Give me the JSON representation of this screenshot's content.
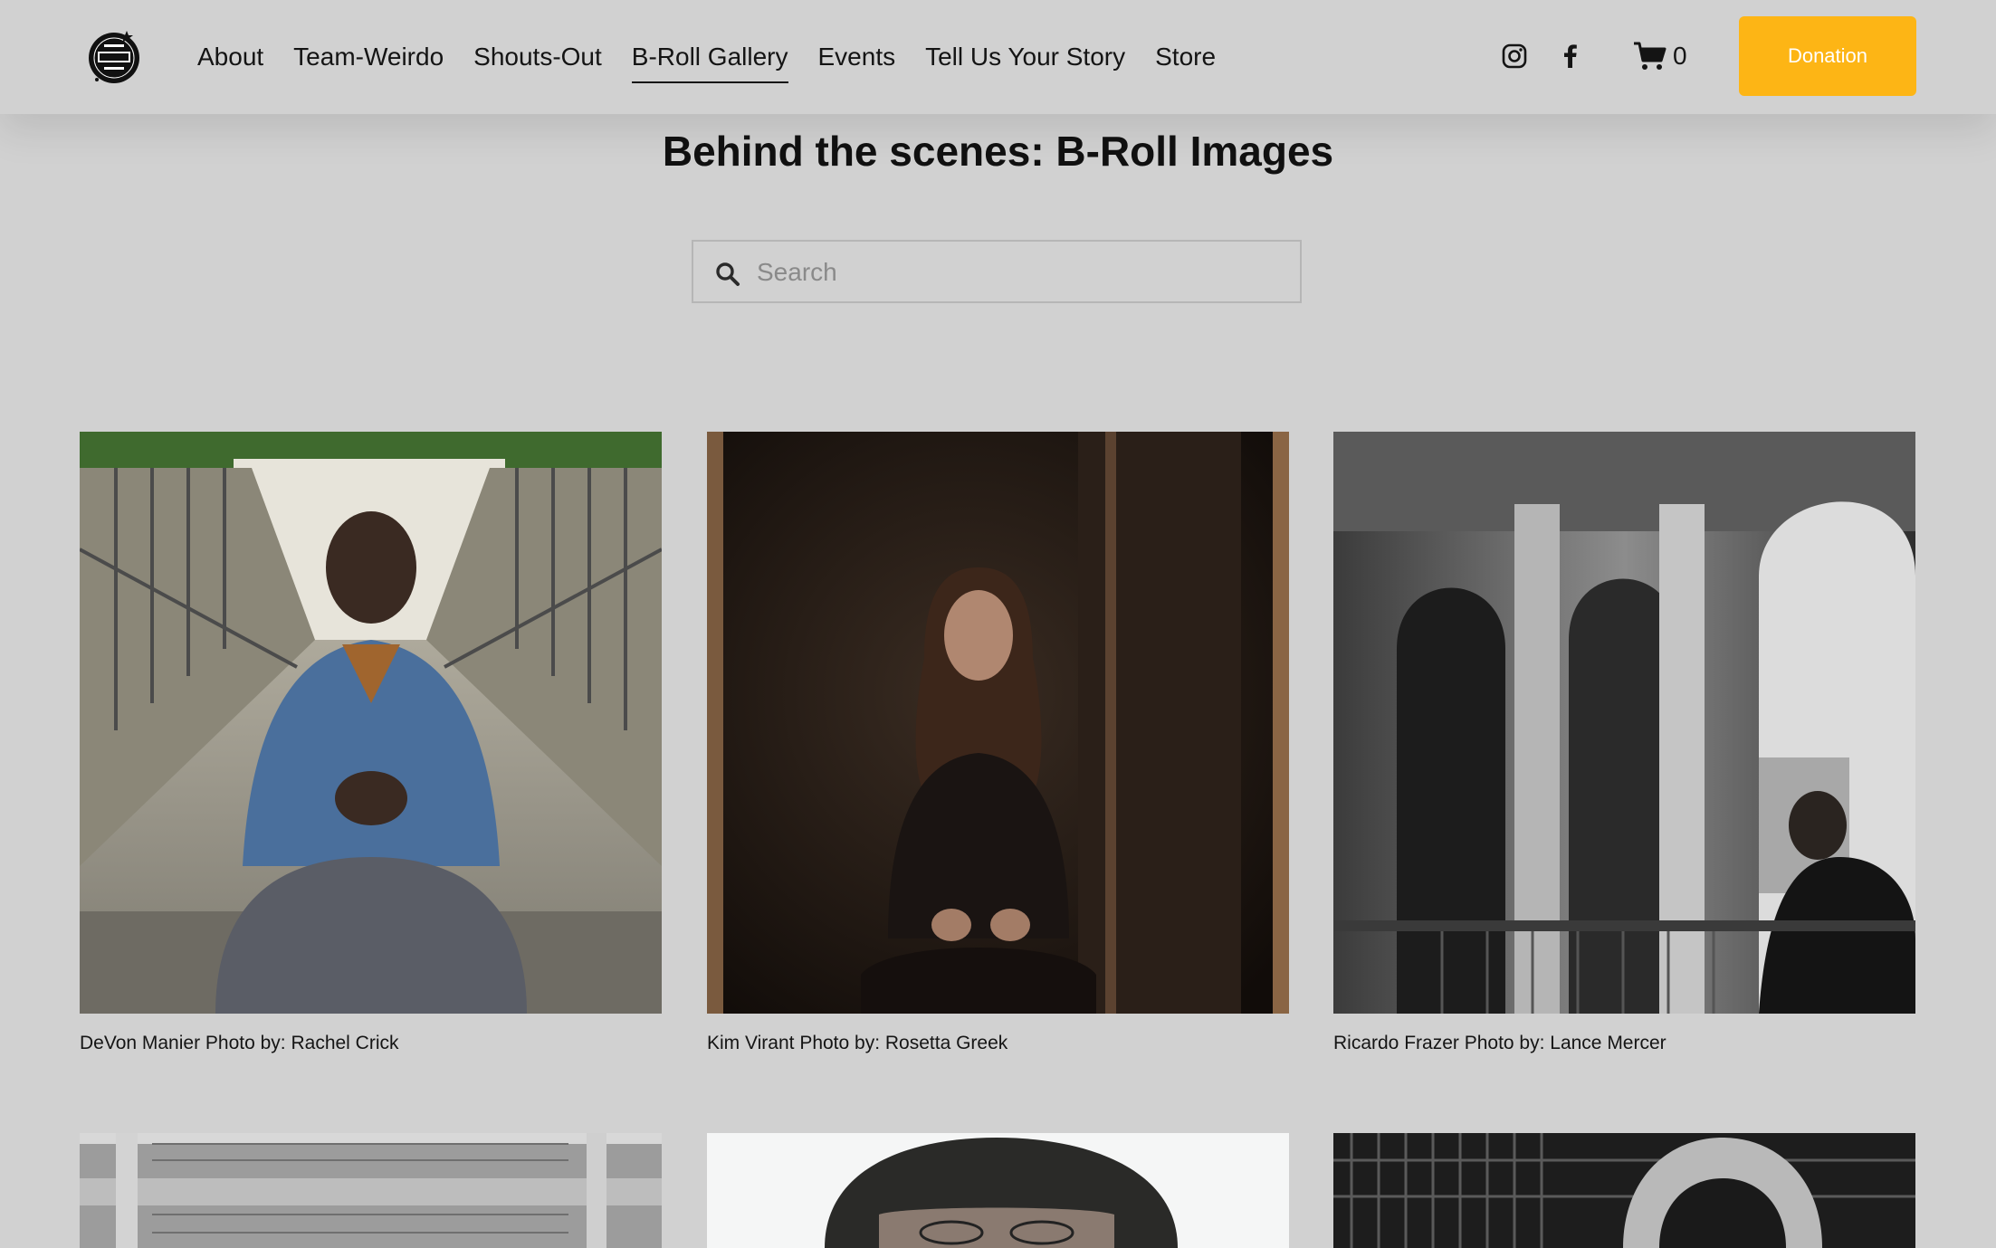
{
  "nav": {
    "items": [
      {
        "label": "About",
        "active": false
      },
      {
        "label": "Team-Weirdo",
        "active": false
      },
      {
        "label": "Shouts-Out",
        "active": false
      },
      {
        "label": "B-Roll Gallery",
        "active": true
      },
      {
        "label": "Events",
        "active": false
      },
      {
        "label": "Tell Us Your Story",
        "active": false
      },
      {
        "label": "Store",
        "active": false
      }
    ]
  },
  "header": {
    "logo_icon": "weirdos-logo-icon",
    "social_icons": [
      "instagram-icon",
      "facebook-icon"
    ],
    "cart_count": "0",
    "donation_label": "Donation",
    "accent_color": "#fdb515"
  },
  "page": {
    "title": "Behind the scenes: B-Roll Images"
  },
  "search": {
    "placeholder": "Search",
    "value": ""
  },
  "gallery": {
    "items": [
      {
        "caption": "DeVon Manier Photo by: Rachel Crick"
      },
      {
        "caption": "Kim Virant Photo by: Rosetta Greek"
      },
      {
        "caption": "Ricardo Frazer Photo by: Lance Mercer"
      },
      {
        "caption": ""
      },
      {
        "caption": ""
      },
      {
        "caption": ""
      }
    ]
  }
}
